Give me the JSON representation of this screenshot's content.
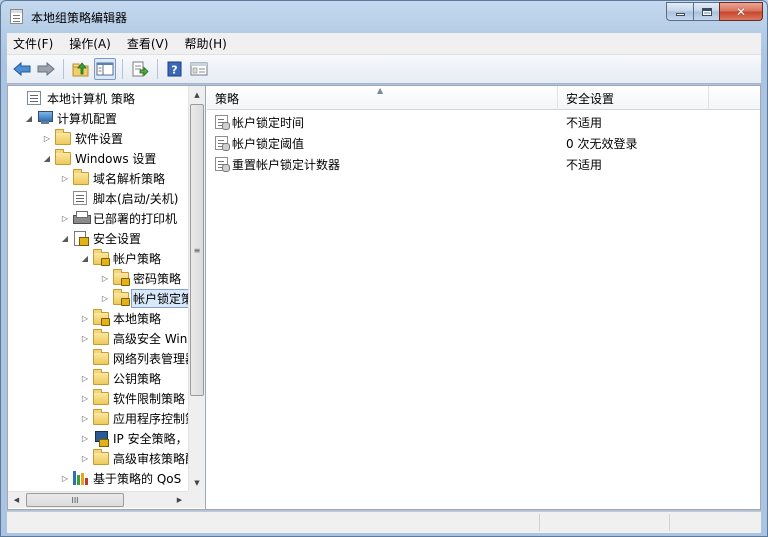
{
  "window": {
    "title": "本地组策略编辑器",
    "minimize_glyph": "",
    "maximize_glyph": "",
    "close_glyph": "✕"
  },
  "menu": [
    "文件(F)",
    "操作(A)",
    "查看(V)",
    "帮助(H)"
  ],
  "toolbar": {
    "buttons": [
      "back-icon",
      "forward-icon",
      "up-folder-icon",
      "show-hide-tree-icon",
      "export-list-icon",
      "help-icon",
      "properties-icon"
    ]
  },
  "tree": {
    "rows": [
      {
        "label": "本地计算机 策略",
        "icon": "computer-policy-icon",
        "level": 0,
        "expander": ""
      },
      {
        "label": "计算机配置",
        "icon": "computer-icon",
        "level": 1,
        "expander": "◢"
      },
      {
        "label": "软件设置",
        "icon": "folder-icon",
        "level": 2,
        "expander": "▷"
      },
      {
        "label": "Windows 设置",
        "icon": "folder-icon",
        "level": 2,
        "expander": "◢"
      },
      {
        "label": "域名解析策略",
        "icon": "folder-icon",
        "level": 3,
        "expander": "▷"
      },
      {
        "label": "脚本(启动/关机)",
        "icon": "script-icon",
        "level": 3,
        "expander": ""
      },
      {
        "label": "已部署的打印机",
        "icon": "printer-icon",
        "level": 3,
        "expander": "▷"
      },
      {
        "label": "安全设置",
        "icon": "security-icon",
        "level": 3,
        "expander": "◢"
      },
      {
        "label": "帐户策略",
        "icon": "locked-folder-icon",
        "level": 4,
        "expander": "◢"
      },
      {
        "label": "密码策略",
        "icon": "locked-folder-icon",
        "level": 5,
        "expander": "▷"
      },
      {
        "label": "帐户锁定策略",
        "icon": "locked-folder-icon",
        "level": 5,
        "expander": "▷",
        "selected": true
      },
      {
        "label": "本地策略",
        "icon": "locked-folder-icon",
        "level": 4,
        "expander": "▷"
      },
      {
        "label": "高级安全 Windows 防火墙",
        "icon": "folder-icon",
        "level": 4,
        "expander": "▷"
      },
      {
        "label": "网络列表管理器策略",
        "icon": "folder-icon",
        "level": 4,
        "expander": ""
      },
      {
        "label": "公钥策略",
        "icon": "folder-icon",
        "level": 4,
        "expander": "▷"
      },
      {
        "label": "软件限制策略",
        "icon": "folder-icon",
        "level": 4,
        "expander": "▷"
      },
      {
        "label": "应用程序控制策略",
        "icon": "folder-icon",
        "level": 4,
        "expander": "▷"
      },
      {
        "label": "IP 安全策略，",
        "icon": "ipsec-icon",
        "level": 4,
        "expander": "▷"
      },
      {
        "label": "高级审核策略配置",
        "icon": "folder-icon",
        "level": 4,
        "expander": "▷"
      },
      {
        "label": "基于策略的 QoS",
        "icon": "qos-icon",
        "level": 3,
        "expander": "▷"
      }
    ],
    "vscroll": {
      "up": "▲",
      "down": "▼",
      "grip": "≡"
    },
    "hscroll": {
      "left": "◀",
      "right": "▶",
      "grip": "III"
    }
  },
  "list": {
    "columns": [
      "策略",
      "安全设置"
    ],
    "sort_glyph": "▲",
    "rows": [
      {
        "policy": "帐户锁定时间",
        "setting": "不适用"
      },
      {
        "policy": "帐户锁定阈值",
        "setting": "0 次无效登录"
      },
      {
        "policy": "重置帐户锁定计数器",
        "setting": "不适用"
      }
    ]
  },
  "colors": {
    "selection_bg": "#d9e9f9",
    "selection_border": "#7da2ce",
    "frame": "#aac4e2",
    "close_button": "#c7452b"
  }
}
